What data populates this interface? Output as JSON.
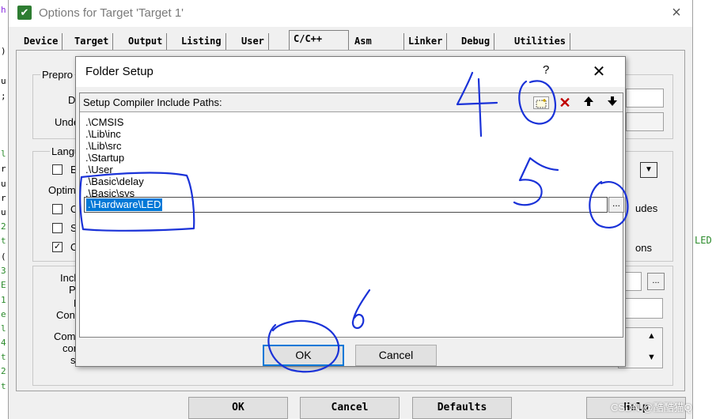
{
  "window": {
    "title": "Options for Target 'Target 1'",
    "close_glyph": "×",
    "icon": "keil-uvision-icon"
  },
  "tabs": [
    {
      "label": "Device"
    },
    {
      "label": "Target"
    },
    {
      "label": "Output"
    },
    {
      "label": "Listing"
    },
    {
      "label": "User"
    },
    {
      "label": "C/C++",
      "active": true
    },
    {
      "label": "Asm"
    },
    {
      "label": "Linker"
    },
    {
      "label": "Debug"
    },
    {
      "label": "Utilities"
    }
  ],
  "cc_tab": {
    "preproc_label": "Prepro",
    "define_label": "Def",
    "undefine_label": "Unde",
    "language_label": "Langu",
    "execute_only_label": "Ex",
    "optimization_label": "Optimiz",
    "opt_check1_label": "Op",
    "opt_check2_label": "Sp",
    "opt_check3_label": "On",
    "opt_check3_checked": "✓",
    "right_includes_label": "udes",
    "right_options_label": "ons",
    "include_paths_label_1": "Inclu",
    "include_paths_label_2": "Pat",
    "misc_controls_label_1": "M",
    "misc_controls_label_2": "Contr",
    "compiler_string_label_1": "Comp",
    "compiler_string_label_2": "cont",
    "compiler_string_label_3": "stri",
    "include_browse_glyph": "..."
  },
  "buttons": {
    "ok": "OK",
    "cancel": "Cancel",
    "defaults": "Defaults",
    "help": "Help"
  },
  "folder_dialog": {
    "title": "Folder Setup",
    "help_glyph": "?",
    "close_glyph": "✕",
    "header_label": "Setup Compiler Include Paths:",
    "toolbar": {
      "new_icon": "new-folder-icon",
      "delete_icon": "delete-icon",
      "up_icon": "move-up-icon",
      "down_icon": "move-down-icon"
    },
    "paths": [
      ".\\CMSIS",
      ".\\Lib\\inc",
      ".\\Lib\\src",
      ".\\Startup",
      ".\\User",
      ".\\Basic\\delay",
      ".\\Basic\\sys"
    ],
    "editing_value": ".\\Hardware\\LED",
    "browse_glyph": "...",
    "ok_label": "OK",
    "cancel_label": "Cancel"
  },
  "annotations": {
    "step4": "4",
    "step5": "5",
    "step6": "6"
  },
  "background": {
    "right_code_text": "LED",
    "left_code_chars": [
      "h",
      ")",
      "u",
      ";",
      "l",
      "r",
      "u",
      "r",
      "u",
      "2",
      "t",
      "(",
      "3",
      "E",
      "1",
      "e",
      "l",
      "4",
      "t",
      "2",
      "t"
    ]
  },
  "watermark": "CSDN @酷酷猫Q"
}
